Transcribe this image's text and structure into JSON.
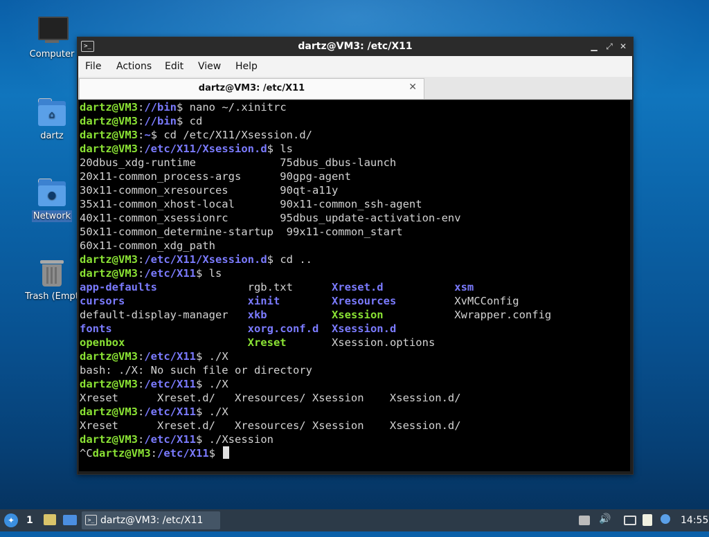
{
  "desktop": {
    "icons": [
      {
        "label": "Computer"
      },
      {
        "label": "dartz"
      },
      {
        "label": "Network"
      },
      {
        "label": "Trash (Empt"
      }
    ]
  },
  "window": {
    "title": "dartz@VM3: /etc/X11",
    "app_icon_glyph": ">_",
    "controls": {
      "minimize": "▁",
      "maximize": "⤢",
      "close": "✕"
    },
    "menu": [
      "File",
      "Actions",
      "Edit",
      "View",
      "Help"
    ],
    "tab": {
      "label": "dartz@VM3: /etc/X11",
      "close": "✕"
    }
  },
  "terminal": {
    "lines": [
      [
        [
          "g",
          "dartz@VM3"
        ],
        [
          "w",
          ":"
        ],
        [
          "b",
          "//bin"
        ],
        [
          "w",
          "$ nano ~/.xinitrc"
        ]
      ],
      [
        [
          "g",
          "dartz@VM3"
        ],
        [
          "w",
          ":"
        ],
        [
          "b",
          "//bin"
        ],
        [
          "w",
          "$ cd"
        ]
      ],
      [
        [
          "g",
          "dartz@VM3"
        ],
        [
          "w",
          ":"
        ],
        [
          "b",
          "~"
        ],
        [
          "w",
          "$ cd /etc/X11/Xsession.d/"
        ]
      ],
      [
        [
          "g",
          "dartz@VM3"
        ],
        [
          "w",
          ":"
        ],
        [
          "b",
          "/etc/X11/Xsession.d"
        ],
        [
          "w",
          "$ ls"
        ]
      ],
      [
        [
          "w",
          "20dbus_xdg-runtime             75dbus_dbus-launch"
        ]
      ],
      [
        [
          "w",
          "20x11-common_process-args      90gpg-agent"
        ]
      ],
      [
        [
          "w",
          "30x11-common_xresources        90qt-a11y"
        ]
      ],
      [
        [
          "w",
          "35x11-common_xhost-local       90x11-common_ssh-agent"
        ]
      ],
      [
        [
          "w",
          "40x11-common_xsessionrc        95dbus_update-activation-env"
        ]
      ],
      [
        [
          "w",
          "50x11-common_determine-startup  99x11-common_start"
        ]
      ],
      [
        [
          "w",
          "60x11-common_xdg_path"
        ]
      ],
      [
        [
          "g",
          "dartz@VM3"
        ],
        [
          "w",
          ":"
        ],
        [
          "b",
          "/etc/X11/Xsession.d"
        ],
        [
          "w",
          "$ cd .."
        ]
      ],
      [
        [
          "g",
          "dartz@VM3"
        ],
        [
          "w",
          ":"
        ],
        [
          "b",
          "/etc/X11"
        ],
        [
          "w",
          "$ ls"
        ]
      ],
      [
        [
          "b",
          "app-defaults"
        ],
        [
          "w",
          "              rgb.txt      "
        ],
        [
          "b",
          "Xreset.d"
        ],
        [
          "w",
          "           "
        ],
        [
          "b",
          "xsm"
        ]
      ],
      [
        [
          "b",
          "cursors"
        ],
        [
          "w",
          "                   "
        ],
        [
          "b",
          "xinit"
        ],
        [
          "w",
          "        "
        ],
        [
          "b",
          "Xresources"
        ],
        [
          "w",
          "         XvMCConfig"
        ]
      ],
      [
        [
          "w",
          "default-display-manager   "
        ],
        [
          "b",
          "xkb"
        ],
        [
          "w",
          "          "
        ],
        [
          "g",
          "Xsession"
        ],
        [
          "w",
          "           Xwrapper.config"
        ]
      ],
      [
        [
          "b",
          "fonts"
        ],
        [
          "w",
          "                     "
        ],
        [
          "b",
          "xorg.conf.d"
        ],
        [
          "w",
          "  "
        ],
        [
          "b",
          "Xsession.d"
        ]
      ],
      [
        [
          "g",
          "openbox"
        ],
        [
          "w",
          "                   "
        ],
        [
          "g",
          "Xreset"
        ],
        [
          "w",
          "       Xsession.options"
        ]
      ],
      [
        [
          "g",
          "dartz@VM3"
        ],
        [
          "w",
          ":"
        ],
        [
          "b",
          "/etc/X11"
        ],
        [
          "w",
          "$ ./X"
        ]
      ],
      [
        [
          "w",
          "bash: ./X: No such file or directory"
        ]
      ],
      [
        [
          "g",
          "dartz@VM3"
        ],
        [
          "w",
          ":"
        ],
        [
          "b",
          "/etc/X11"
        ],
        [
          "w",
          "$ ./X"
        ]
      ],
      [
        [
          "w",
          "Xreset      Xreset.d/   Xresources/ Xsession    Xsession.d/"
        ]
      ],
      [
        [
          "g",
          "dartz@VM3"
        ],
        [
          "w",
          ":"
        ],
        [
          "b",
          "/etc/X11"
        ],
        [
          "w",
          "$ ./X"
        ]
      ],
      [
        [
          "w",
          "Xreset      Xreset.d/   Xresources/ Xsession    Xsession.d/"
        ]
      ],
      [
        [
          "g",
          "dartz@VM3"
        ],
        [
          "w",
          ":"
        ],
        [
          "b",
          "/etc/X11"
        ],
        [
          "w",
          "$ ./Xsession"
        ]
      ],
      [
        [
          "w",
          "^C"
        ],
        [
          "g",
          "dartz@VM3"
        ],
        [
          "w",
          ":"
        ],
        [
          "b",
          "/etc/X11"
        ],
        [
          "w",
          "$ "
        ]
      ]
    ]
  },
  "taskbar": {
    "workspace": "1",
    "task_label": "dartz@VM3: /etc/X11",
    "clock": "14:55",
    "volume_glyph": "🔊"
  }
}
